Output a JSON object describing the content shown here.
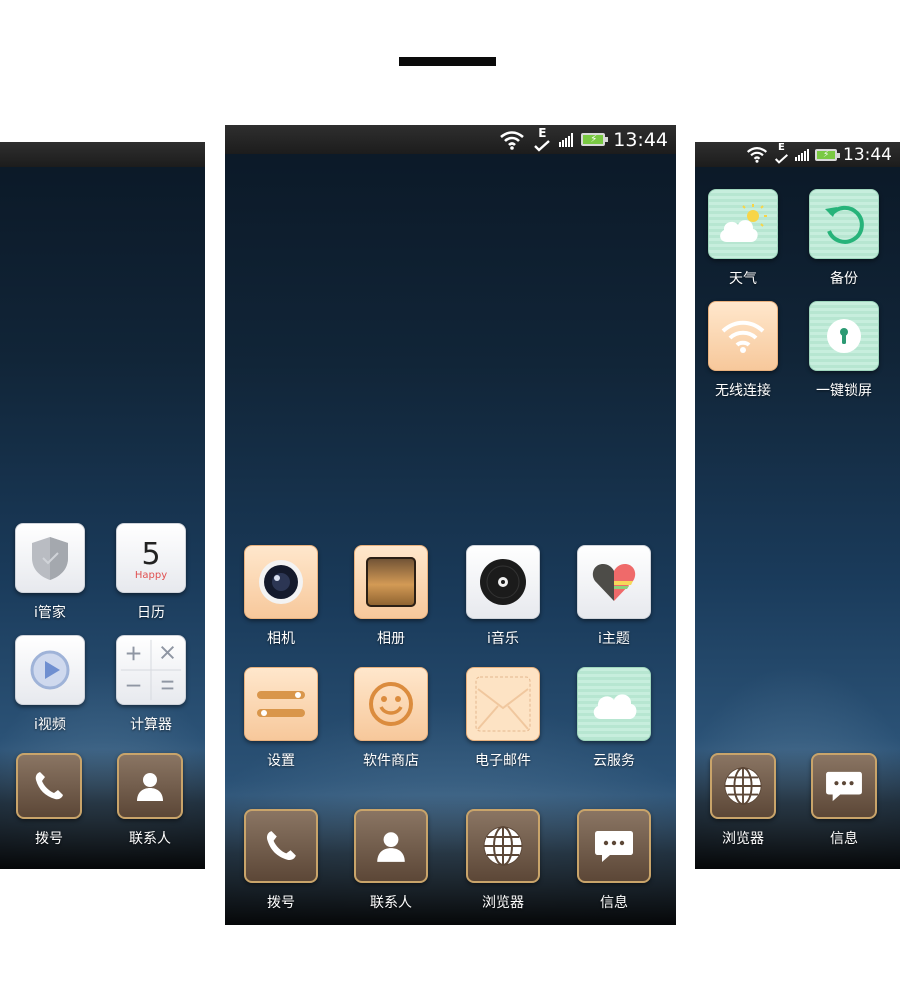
{
  "status": {
    "time": "13:44",
    "net_letter": "E"
  },
  "left_screen": {
    "apps": [
      {
        "label": "i管家",
        "icon": "shield-icon"
      },
      {
        "label": "日历",
        "icon": "calendar-icon",
        "day": "5",
        "sub": "Happy"
      },
      {
        "label": "i视频",
        "icon": "video-play-icon"
      },
      {
        "label": "计算器",
        "icon": "calculator-icon"
      }
    ],
    "dock": [
      {
        "label": "拨号",
        "icon": "phone-icon"
      },
      {
        "label": "联系人",
        "icon": "contact-icon"
      }
    ]
  },
  "center_screen": {
    "apps": [
      {
        "label": "相机",
        "icon": "camera-icon"
      },
      {
        "label": "相册",
        "icon": "gallery-icon"
      },
      {
        "label": "i音乐",
        "icon": "music-disc-icon"
      },
      {
        "label": "i主题",
        "icon": "theme-heart-icon"
      },
      {
        "label": "设置",
        "icon": "settings-sliders-icon"
      },
      {
        "label": "软件商店",
        "icon": "smile-store-icon"
      },
      {
        "label": "电子邮件",
        "icon": "envelope-icon"
      },
      {
        "label": "云服务",
        "icon": "cloud-icon"
      }
    ],
    "dock": [
      {
        "label": "拨号",
        "icon": "phone-icon"
      },
      {
        "label": "联系人",
        "icon": "contact-icon"
      },
      {
        "label": "浏览器",
        "icon": "globe-icon"
      },
      {
        "label": "信息",
        "icon": "message-icon"
      }
    ]
  },
  "right_screen": {
    "apps": [
      {
        "label": "天气",
        "icon": "weather-icon"
      },
      {
        "label": "备份",
        "icon": "backup-icon"
      },
      {
        "label": "无线连接",
        "icon": "wifi-icon"
      },
      {
        "label": "一键锁屏",
        "icon": "lock-icon"
      }
    ],
    "dock": [
      {
        "label": "浏览器",
        "icon": "globe-icon"
      },
      {
        "label": "信息",
        "icon": "message-icon"
      }
    ]
  },
  "colors": {
    "battery": "#7ac943",
    "dock_gold": "#c9a46a",
    "peach": "#f7c89b",
    "mint": "#b7e6d1"
  }
}
